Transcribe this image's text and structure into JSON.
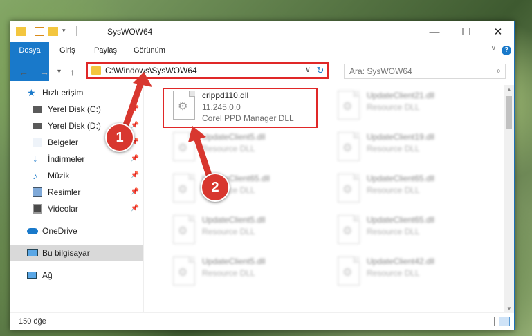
{
  "window": {
    "title": "SysWOW64",
    "minimize": "—",
    "maximize": "☐",
    "close": "✕"
  },
  "ribbon": {
    "tabs": [
      "Dosya",
      "Giriş",
      "Paylaş",
      "Görünüm"
    ],
    "help": "?"
  },
  "address": {
    "path": "C:\\Windows\\SysWOW64",
    "search_placeholder": "Ara: SysWOW64"
  },
  "sidebar": {
    "items": [
      {
        "label": "Hızlı erişim",
        "icon": "star-icon",
        "pinned": false
      },
      {
        "label": "Yerel Disk (C:)",
        "icon": "drive-icon",
        "pinned": true
      },
      {
        "label": "Yerel Disk (D:)",
        "icon": "drive-icon",
        "pinned": true
      },
      {
        "label": "Belgeler",
        "icon": "documents-icon",
        "pinned": true
      },
      {
        "label": "İndirmeler",
        "icon": "download-icon",
        "pinned": true
      },
      {
        "label": "Müzik",
        "icon": "music-icon",
        "pinned": true
      },
      {
        "label": "Resimler",
        "icon": "pictures-icon",
        "pinned": true
      },
      {
        "label": "Videolar",
        "icon": "videos-icon",
        "pinned": true
      },
      {
        "label": "OneDrive",
        "icon": "cloud-icon",
        "pinned": false
      },
      {
        "label": "Bu bilgisayar",
        "icon": "computer-icon",
        "pinned": false,
        "selected": true
      },
      {
        "label": "Ağ",
        "icon": "network-icon",
        "pinned": false
      }
    ]
  },
  "files": [
    {
      "name": "crlppd110.dll",
      "version": "11.245.0.0",
      "desc": "Corel PPD Manager DLL",
      "highlighted": true
    },
    {
      "name": "UpdateClient21.dll",
      "version": "",
      "desc": "Resource DLL"
    },
    {
      "name": "UpdateClient5.dll",
      "version": "",
      "desc": "Resource DLL"
    },
    {
      "name": "UpdateClient19.dll",
      "version": "",
      "desc": "Resource DLL"
    },
    {
      "name": "UpdateClient65.dll",
      "version": "",
      "desc": "Resource DLL"
    },
    {
      "name": "UpdateClient65.dll",
      "version": "",
      "desc": "Resource DLL"
    },
    {
      "name": "UpdateClient5.dll",
      "version": "",
      "desc": "Resource DLL"
    },
    {
      "name": "UpdateClient65.dll",
      "version": "",
      "desc": "Resource DLL"
    },
    {
      "name": "UpdateClient5.dll",
      "version": "",
      "desc": "Resource DLL"
    },
    {
      "name": "UpdateClient42.dll",
      "version": "",
      "desc": "Resource DLL"
    }
  ],
  "status": {
    "count": "150 öğe"
  },
  "annotations": {
    "badge1": "1",
    "badge2": "2",
    "color": "#d8372f"
  }
}
